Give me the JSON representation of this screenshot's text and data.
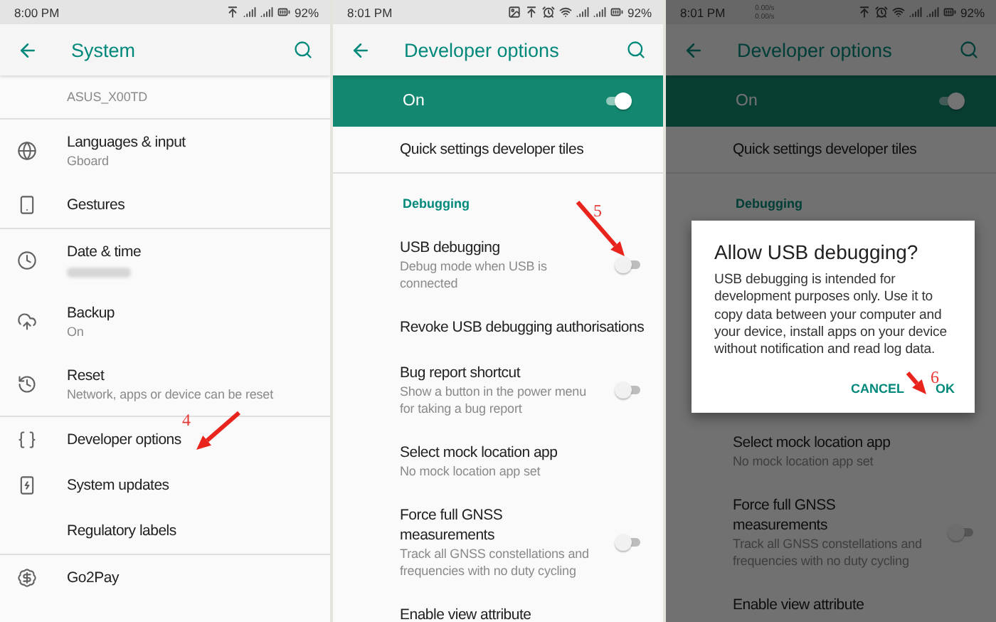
{
  "panels": [
    {
      "status_bar": {
        "time": "8:00 PM",
        "battery": "92%"
      },
      "app_bar": {
        "title": "System"
      },
      "dimmed": false,
      "sections": [
        [
          {
            "kind": "row",
            "subtitle": "ASUS_X00TD"
          }
        ],
        [
          {
            "kind": "row",
            "title": "Languages & input",
            "subtitle": "Gboard"
          },
          {
            "kind": "row",
            "title": "Gestures"
          }
        ],
        [
          {
            "kind": "row",
            "title": "Date & time",
            "blurred": true
          },
          {
            "kind": "row",
            "title": "Backup",
            "subtitle": "On"
          },
          {
            "kind": "row",
            "title": "Reset",
            "subtitle": "Network, apps or device can be reset"
          }
        ],
        [
          {
            "kind": "row",
            "title": "Developer options"
          },
          {
            "kind": "row",
            "title": "System updates"
          },
          {
            "kind": "row",
            "title": "Regulatory labels"
          }
        ],
        [
          {
            "kind": "row",
            "title": "Go2Pay"
          }
        ]
      ],
      "annotation": {
        "label": "4"
      }
    },
    {
      "status_bar": {
        "time": "8:01 PM",
        "battery": "92%"
      },
      "app_bar": {
        "title": "Developer options"
      },
      "dimmed": false,
      "master_switch": {
        "label": "On",
        "on": true
      },
      "sections": [
        [
          {
            "kind": "row",
            "title": "Quick settings developer tiles"
          }
        ],
        [
          {
            "kind": "header",
            "title": "Debugging"
          },
          {
            "kind": "toggle",
            "title": "USB debugging",
            "subtitle": "Debug mode when USB is connected",
            "on": false
          },
          {
            "kind": "row",
            "title": "Revoke USB debugging authorisations"
          },
          {
            "kind": "toggle",
            "title": "Bug report shortcut",
            "subtitle": "Show a button in the power menu for taking a bug report",
            "on": false
          },
          {
            "kind": "row",
            "title": "Select mock location app",
            "subtitle": "No mock location app set"
          },
          {
            "kind": "toggle",
            "title": "Force full GNSS measurements",
            "subtitle": "Track all GNSS constellations and frequencies with no duty cycling",
            "on": false
          },
          {
            "kind": "row",
            "title": "Enable view attribute"
          }
        ]
      ],
      "annotation": {
        "label": "5"
      }
    },
    {
      "status_bar": {
        "time": "8:01 PM",
        "net_speed": [
          "0.00/s",
          "0.00/s"
        ],
        "battery": "92%"
      },
      "app_bar": {
        "title": "Developer options"
      },
      "dimmed": true,
      "master_switch": {
        "label": "On",
        "on": true
      },
      "sections": [
        [
          {
            "kind": "row",
            "title": "Quick settings developer tiles"
          }
        ],
        [
          {
            "kind": "header",
            "title": "Debugging"
          },
          {
            "kind": "dialog",
            "title": "Allow USB debugging?",
            "message": "USB debugging is intended for development purposes only. Use it to copy data between your computer and your device, install apps on your device without notification and read log data.",
            "buttons": [
              "CANCEL",
              "OK"
            ]
          },
          {
            "kind": "row",
            "title": "Select mock location app",
            "subtitle": "No mock location app set"
          },
          {
            "kind": "toggle",
            "title": "Force full GNSS measurements",
            "subtitle": "Track all GNSS constellations and frequencies with no duty cycling",
            "on": false
          },
          {
            "kind": "row",
            "title": "Enable view attribute"
          }
        ]
      ],
      "annotation": {
        "label": "6"
      }
    }
  ]
}
